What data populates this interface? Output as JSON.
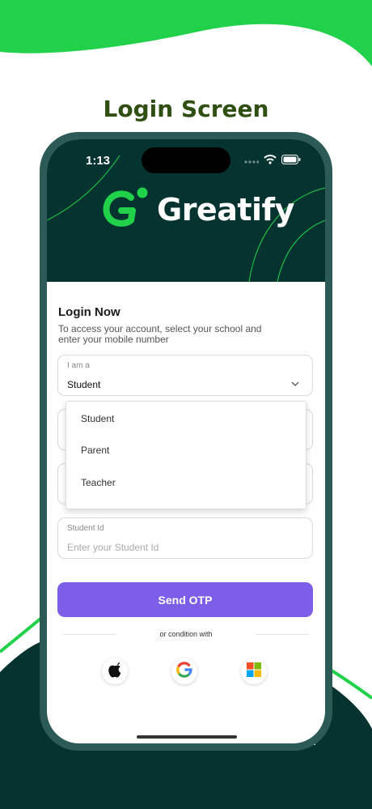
{
  "headline": "Login Screen",
  "status": {
    "time": "1:13"
  },
  "brand": {
    "name": "Greatify"
  },
  "login": {
    "title": "Login Now",
    "subtitle": "To access your account, select your school and enter your mobile number"
  },
  "role_field": {
    "label": "I am a",
    "value": "Student"
  },
  "role_options": [
    "Student",
    "Parent",
    "Teacher"
  ],
  "student_id_field": {
    "label": "Student Id",
    "placeholder": "Enter your Student Id"
  },
  "send_otp": "Send OTP",
  "divider_text": "or condition with",
  "social": [
    "apple-icon",
    "google-icon",
    "microsoft-icon"
  ],
  "colors": {
    "brand_green": "#22d14a",
    "dark_teal": "#05332f",
    "phone_frame": "#2c5a56",
    "headline": "#2f5012",
    "button_purple": "#7d5ee8"
  }
}
